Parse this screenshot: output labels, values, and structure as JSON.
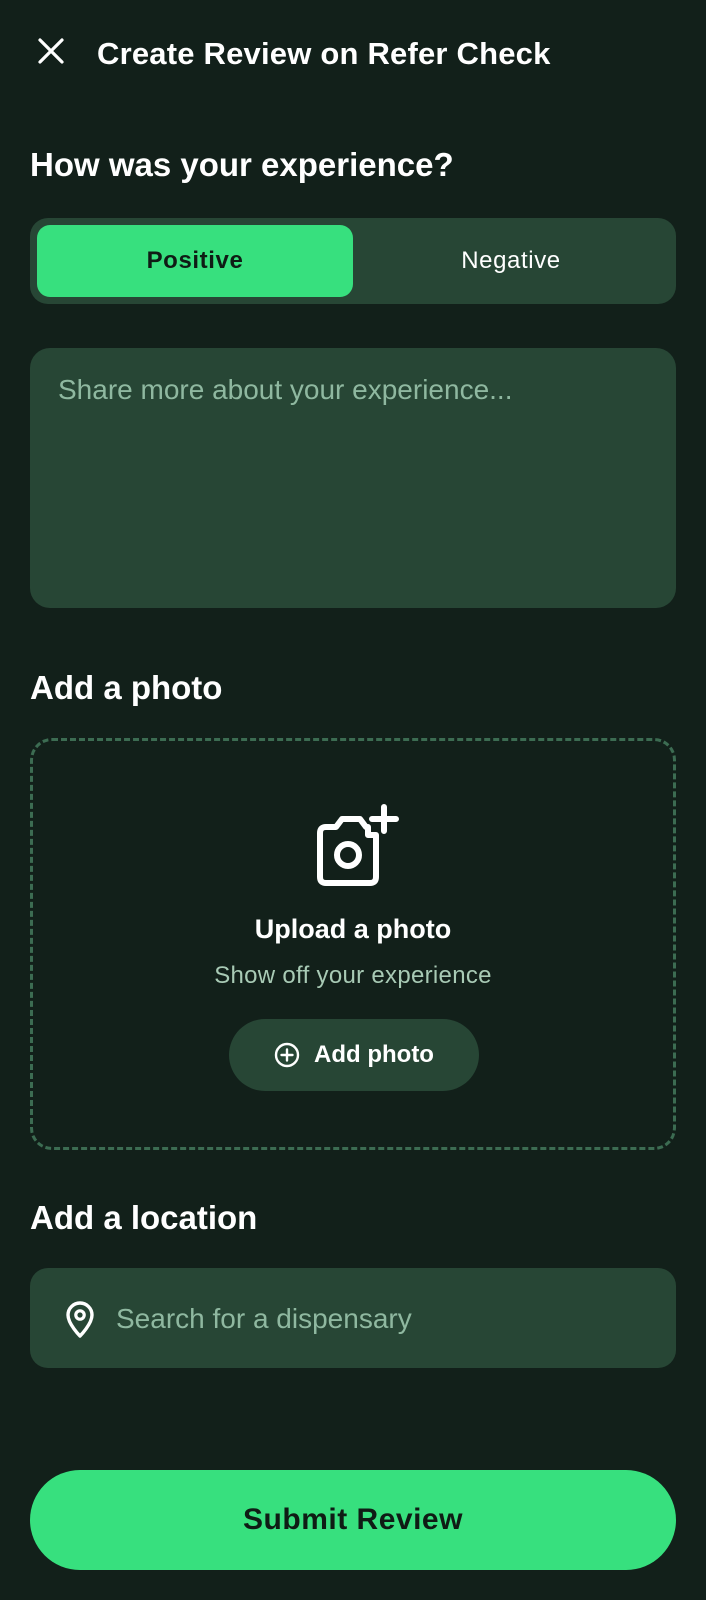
{
  "header": {
    "title": "Create Review on Refer Check",
    "close_icon": "close-icon"
  },
  "experience": {
    "heading": "How was your experience?",
    "options": [
      "Positive",
      "Negative"
    ],
    "selected": "Positive",
    "placeholder": "Share more about your experience...",
    "value": ""
  },
  "photo": {
    "heading": "Add a photo",
    "icon": "camera-plus-icon",
    "title": "Upload a photo",
    "subtitle": "Show off your experience",
    "button_label": "Add photo",
    "button_icon": "plus-circle-icon"
  },
  "location": {
    "heading": "Add a location",
    "icon": "location-pin-icon",
    "placeholder": "Search for a dispensary",
    "value": ""
  },
  "submit": {
    "label": "Submit Review"
  },
  "colors": {
    "background": "#12201a",
    "surface": "#274635",
    "accent": "#37e07e",
    "placeholder": "#8fb8a0",
    "dashed_border": "#3c6c52"
  }
}
